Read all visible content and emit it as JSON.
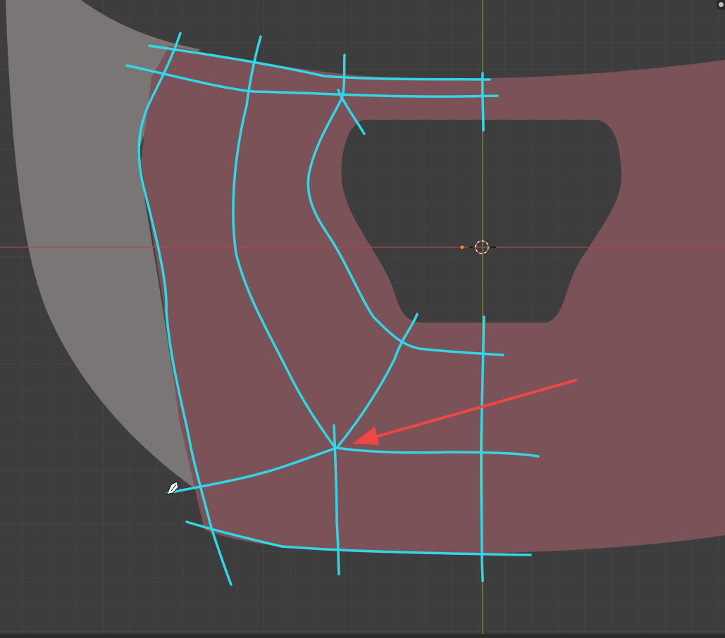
{
  "viewport": {
    "background": "#3d3d3d",
    "grid_color": "#4d4d4d",
    "x_axis_color": "#c0404a",
    "y_axis_color": "#8aa12e"
  },
  "mesh": {
    "face_color": "#7a5258",
    "side_surface_color": "#7b7676",
    "hole_color": "#3d3d3d"
  },
  "annotation": {
    "stroke_color": "#33d6e6",
    "arrow_color": "#f04646"
  },
  "cursor": {
    "icon": "pencil-icon"
  },
  "origin": {
    "icon": "3d-cursor-icon",
    "origin_dot_color": "#f08c1e"
  }
}
